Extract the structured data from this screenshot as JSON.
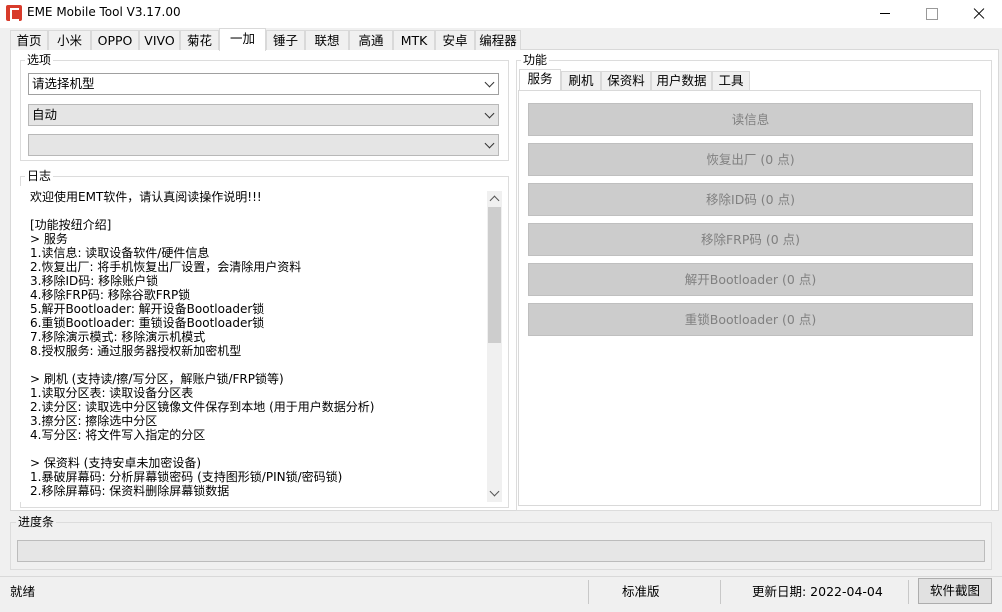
{
  "window": {
    "title": "EME Mobile Tool V3.17.00"
  },
  "main_tabs": [
    {
      "label": "首页"
    },
    {
      "label": "小米"
    },
    {
      "label": "OPPO"
    },
    {
      "label": "VIVO"
    },
    {
      "label": "菊花"
    },
    {
      "label": "一加",
      "active": true
    },
    {
      "label": "锤子"
    },
    {
      "label": "联想"
    },
    {
      "label": "高通"
    },
    {
      "label": "MTK"
    },
    {
      "label": "安卓"
    },
    {
      "label": "编程器"
    }
  ],
  "options": {
    "group_label": "选项",
    "model_select": "请选择机型",
    "mode_select": "自动",
    "third_select": ""
  },
  "log": {
    "group_label": "日志",
    "lines": [
      "欢迎使用EMT软件，请认真阅读操作说明!!!",
      "",
      "[功能按纽介绍]",
      "> 服务",
      "1.读信息: 读取设备软件/硬件信息",
      "2.恢复出厂: 将手机恢复出厂设置，会清除用户资料",
      "3.移除ID码: 移除账户锁",
      "4.移除FRP码: 移除谷歌FRP锁",
      "5.解开Bootloader: 解开设备Bootloader锁",
      "6.重锁Bootloader: 重锁设备Bootloader锁",
      "7.移除演示模式: 移除演示机模式",
      "8.授权服务: 通过服务器授权新加密机型",
      "",
      "> 刷机 (支持读/擦/写分区，解账户锁/FRP锁等)",
      "1.读取分区表: 读取设备分区表",
      "2.读分区: 读取选中分区镜像文件保存到本地 (用于用户数据分析)",
      "3.擦分区: 擦除选中分区",
      "4.写分区: 将文件写入指定的分区",
      "",
      "> 保资料 (支持安卓未加密设备)",
      "1.暴破屏幕码: 分析屏幕锁密码 (支持图形锁/PIN锁/密码锁)",
      "2.移除屏幕码: 保资料删除屏幕锁数据"
    ]
  },
  "function": {
    "group_label": "功能",
    "tabs": [
      {
        "label": "服务",
        "active": true
      },
      {
        "label": "刷机"
      },
      {
        "label": "保资料"
      },
      {
        "label": "用户数据"
      },
      {
        "label": "工具"
      }
    ],
    "buttons": [
      {
        "label": "读信息"
      },
      {
        "label": "恢复出厂 (0 点)"
      },
      {
        "label": "移除ID码 (0 点)"
      },
      {
        "label": "移除FRP码 (0 点)"
      },
      {
        "label": "解开Bootloader (0 点)"
      },
      {
        "label": "重锁Bootloader (0 点)"
      }
    ]
  },
  "progress": {
    "label": "进度条",
    "value": 0
  },
  "status": {
    "state": "就绪",
    "edition": "标准版",
    "update_date": "更新日期:  2022-04-04",
    "screenshot_button": "软件截图"
  }
}
